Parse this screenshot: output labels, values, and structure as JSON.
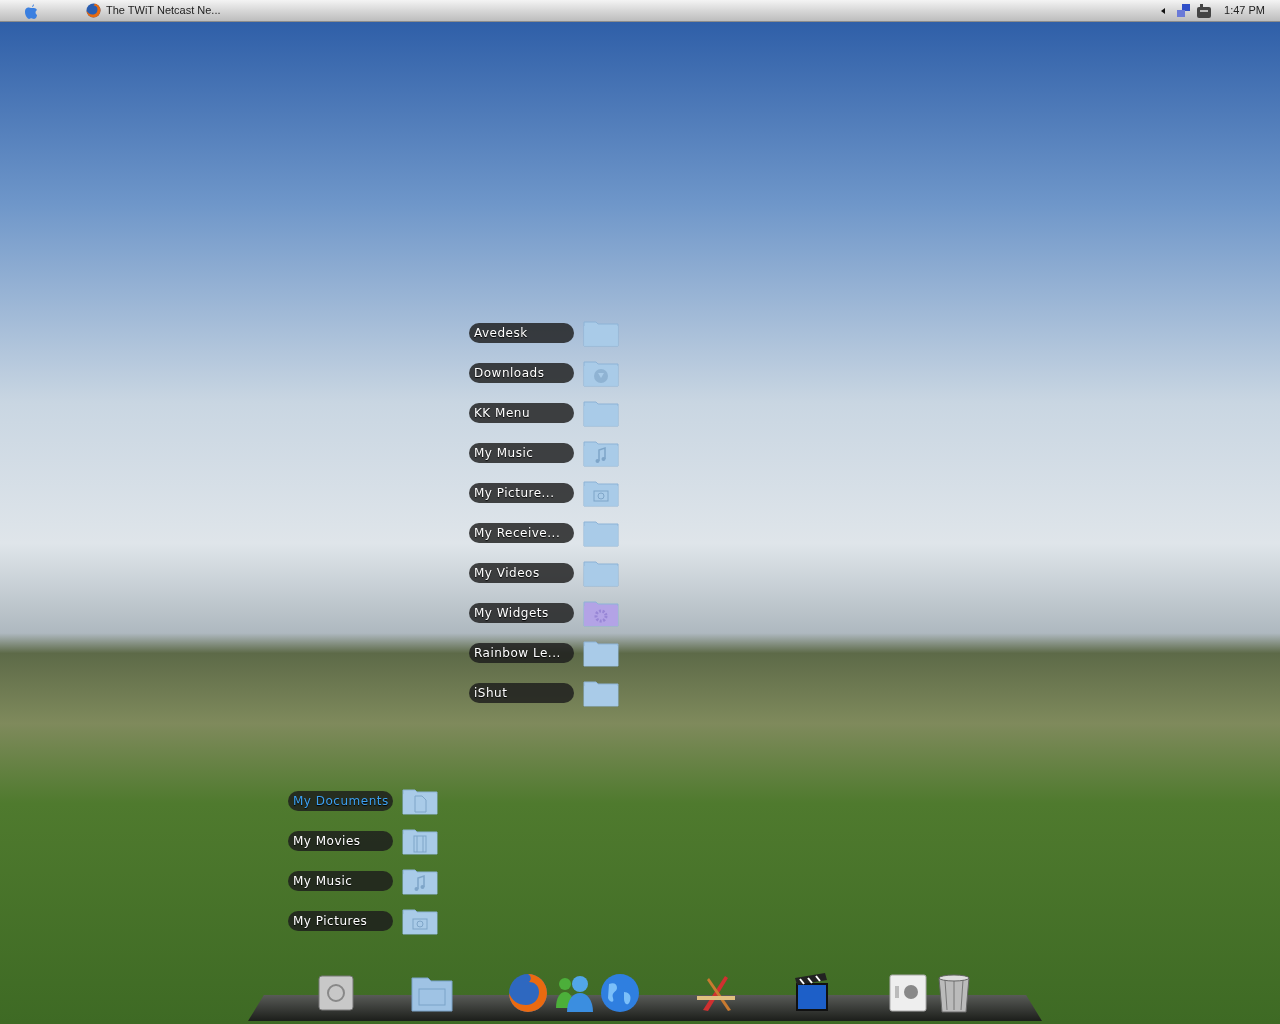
{
  "menubar": {
    "app_title": "The TWiT Netcast Ne...",
    "clock": "1:47 PM"
  },
  "stacks": [
    {
      "items": [
        {
          "label": "Avedesk",
          "kind": "plain",
          "selected": false
        },
        {
          "label": "Downloads",
          "kind": "download",
          "selected": false
        },
        {
          "label": "KK Menu",
          "kind": "plain",
          "selected": false
        },
        {
          "label": "My Music",
          "kind": "music",
          "selected": false
        },
        {
          "label": "My Picture...",
          "kind": "picture",
          "selected": false
        },
        {
          "label": "My Receive...",
          "kind": "plain",
          "selected": false
        },
        {
          "label": "My Videos",
          "kind": "plain",
          "selected": false
        },
        {
          "label": "My Widgets",
          "kind": "widget",
          "selected": false
        },
        {
          "label": "Rainbow Le...",
          "kind": "plain",
          "selected": false
        },
        {
          "label": "iShut",
          "kind": "plain",
          "selected": false
        }
      ]
    },
    {
      "items": [
        {
          "label": "My Documents",
          "kind": "document",
          "selected": true
        },
        {
          "label": "My Movies",
          "kind": "movie",
          "selected": false
        },
        {
          "label": "My Music",
          "kind": "music",
          "selected": false
        },
        {
          "label": "My Pictures",
          "kind": "picture",
          "selected": false
        }
      ]
    }
  ],
  "dock": {
    "groups": [
      [
        {
          "kind": "drive"
        }
      ],
      [
        {
          "kind": "folder"
        }
      ],
      [
        {
          "kind": "browser"
        },
        {
          "kind": "messenger"
        },
        {
          "kind": "globe"
        }
      ],
      [
        {
          "kind": "tools"
        }
      ],
      [
        {
          "kind": "clapper"
        }
      ],
      [
        {
          "kind": "device"
        },
        {
          "kind": "trash"
        }
      ]
    ]
  }
}
